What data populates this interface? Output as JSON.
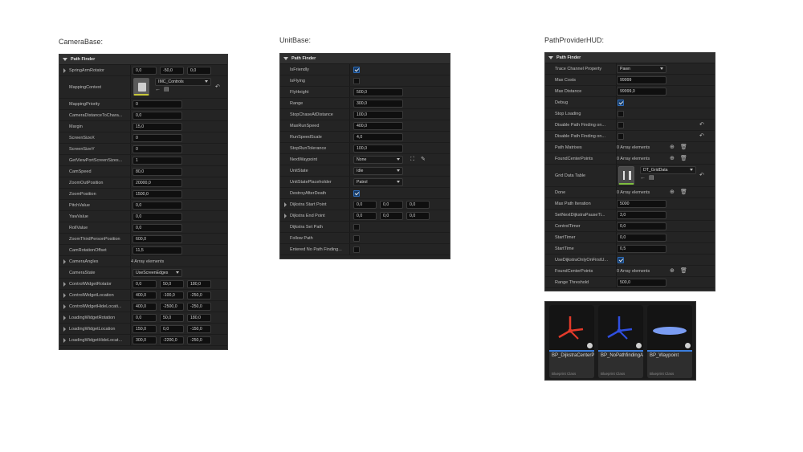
{
  "titles": {
    "camera": "CameraBase:",
    "unit": "UnitBase:",
    "hud": "PathProviderHUD:"
  },
  "camera_panel": {
    "header": "Path Finder",
    "spring": {
      "label": "SpringArmRotator",
      "v": [
        "0,0",
        "-50,0",
        "0,0"
      ]
    },
    "mapping": {
      "label": "MappingContext",
      "value": "IMC_Controls"
    },
    "rows": [
      {
        "label": "MappingPriority",
        "value": "0"
      },
      {
        "label": "CameraDistanceToChara...",
        "value": "0,0"
      },
      {
        "label": "Margin",
        "value": "15,0"
      },
      {
        "label": "ScreenSizeX",
        "value": "0"
      },
      {
        "label": "ScreenSizeY",
        "value": "0"
      },
      {
        "label": "GetViewPortScreenSizes...",
        "value": "1"
      },
      {
        "label": "CamSpeed",
        "value": "80,0"
      },
      {
        "label": "ZoomOutPosition",
        "value": "20000,0"
      },
      {
        "label": "ZoomPosition",
        "value": "1500,0"
      },
      {
        "label": "PitchValue",
        "value": "0,0"
      },
      {
        "label": "YawValue",
        "value": "0,0"
      },
      {
        "label": "RollValue",
        "value": "0,0"
      },
      {
        "label": "ZoomThirdPersonPosition",
        "value": "600,0"
      },
      {
        "label": "CamRotationOffset",
        "value": "11,5"
      }
    ],
    "angles": {
      "label": "CameraAngles",
      "value": "4 Array elements"
    },
    "state": {
      "label": "CameraState",
      "value": "UseScreenEdges"
    },
    "vectors": [
      {
        "label": "ControlWidgetRotator",
        "v": [
          "0,0",
          "50,0",
          "180,0"
        ]
      },
      {
        "label": "ControlWidgetLocation",
        "v": [
          "400,0",
          "-100,0",
          "-250,0"
        ]
      },
      {
        "label": "ControlWidgetHideLocati...",
        "v": [
          "400,0",
          "-2500,0",
          "-250,0"
        ]
      },
      {
        "label": "LoadingWidgetRotation",
        "v": [
          "0,0",
          "50,0",
          "180,0"
        ]
      },
      {
        "label": "LoadingWidgetLocation",
        "v": [
          "150,0",
          "0,0",
          "-150,0"
        ]
      },
      {
        "label": "LoadingWidgetHideLocat...",
        "v": [
          "300,0",
          "-2200,0",
          "-250,0"
        ]
      }
    ]
  },
  "unit_panel": {
    "header": "Path Finder",
    "rows": [
      {
        "label": "IsFriendly",
        "kind": "check",
        "checked": true
      },
      {
        "label": "IsFlying",
        "kind": "check",
        "checked": false
      },
      {
        "label": "FlyHeight",
        "kind": "num",
        "value": "500,0"
      },
      {
        "label": "Range",
        "kind": "num",
        "value": "300,0"
      },
      {
        "label": "StopChaseAtDistance",
        "kind": "num",
        "value": "100,0"
      },
      {
        "label": "MaxRunSpeed",
        "kind": "num",
        "value": "400,0"
      },
      {
        "label": "RunSpeedScale",
        "kind": "num",
        "value": "4,0"
      },
      {
        "label": "StopRunTolerance",
        "kind": "num",
        "value": "100,0"
      },
      {
        "label": "NextWaypoint",
        "kind": "sel",
        "value": "None"
      },
      {
        "label": "UnitState",
        "kind": "sel",
        "value": "Idle"
      },
      {
        "label": "UnitStatePlaceholder",
        "kind": "sel",
        "value": "Patrol"
      },
      {
        "label": "DestroyAfterDeath",
        "kind": "check",
        "checked": true
      },
      {
        "label": "Dijkstra Start Point",
        "kind": "vec",
        "v": [
          "0,0",
          "0,0",
          "0,0"
        ]
      },
      {
        "label": "Dijkstra End Point",
        "kind": "vec",
        "v": [
          "0,0",
          "0,0",
          "0,0"
        ]
      },
      {
        "label": "Dijkstra Set Path",
        "kind": "check",
        "checked": false
      },
      {
        "label": "Follow Path",
        "kind": "check",
        "checked": false
      },
      {
        "label": "Entered No Path Finding...",
        "kind": "check",
        "checked": false
      }
    ]
  },
  "hud_panel": {
    "header": "Path Finder",
    "rows": [
      {
        "label": "Trace Channel Property",
        "kind": "sel",
        "value": "Pawn"
      },
      {
        "label": "Max Costs",
        "kind": "num",
        "value": "99999"
      },
      {
        "label": "Max Distance",
        "kind": "num",
        "value": "99999,0"
      },
      {
        "label": "Debug",
        "kind": "check",
        "checked": true
      },
      {
        "label": "Stop Loading",
        "kind": "check",
        "checked": false
      },
      {
        "label": "Disable Path Finding on...",
        "kind": "check",
        "checked": false,
        "reset": true
      },
      {
        "label": "Disable Path Finding on...",
        "kind": "check",
        "checked": false,
        "reset": true
      },
      {
        "label": "Path Matrixes",
        "kind": "arr",
        "value": "0 Array elements"
      },
      {
        "label": "FoundCenterPoints",
        "kind": "arr",
        "value": "0 Array elements"
      }
    ],
    "grid": {
      "label": "Grid Data Table",
      "value": "DT_GridData"
    },
    "rows2": [
      {
        "label": "Done",
        "kind": "arr",
        "value": "0 Array elements"
      },
      {
        "label": "Max Path Iteration",
        "kind": "num",
        "value": "5000"
      },
      {
        "label": "SetNextDijkstraPauseTi...",
        "kind": "num",
        "value": "3,0"
      },
      {
        "label": "ControlTimer",
        "kind": "num",
        "value": "0,0"
      },
      {
        "label": "StartTimer",
        "kind": "num",
        "value": "0,0"
      },
      {
        "label": "StartTime",
        "kind": "num",
        "value": "0,5"
      },
      {
        "label": "UseDijkstraOnlyOnFirstU...",
        "kind": "check",
        "checked": true
      },
      {
        "label": "FoundCenterPoints",
        "kind": "arr",
        "value": "0 Array elements"
      },
      {
        "label": "Range Threshold",
        "kind": "num",
        "value": "500,0"
      }
    ]
  },
  "content_browser": {
    "items": [
      {
        "name": "BP_DijkstraCenterPoint",
        "type": "Blueprint Class",
        "icon": "red-gizmo-icon"
      },
      {
        "name": "BP_NoPathfindingArea",
        "type": "Blueprint Class",
        "icon": "blue-gizmo-icon"
      },
      {
        "name": "BP_Waypoint",
        "type": "Blueprint Class",
        "icon": "blue-disc-icon"
      }
    ]
  }
}
